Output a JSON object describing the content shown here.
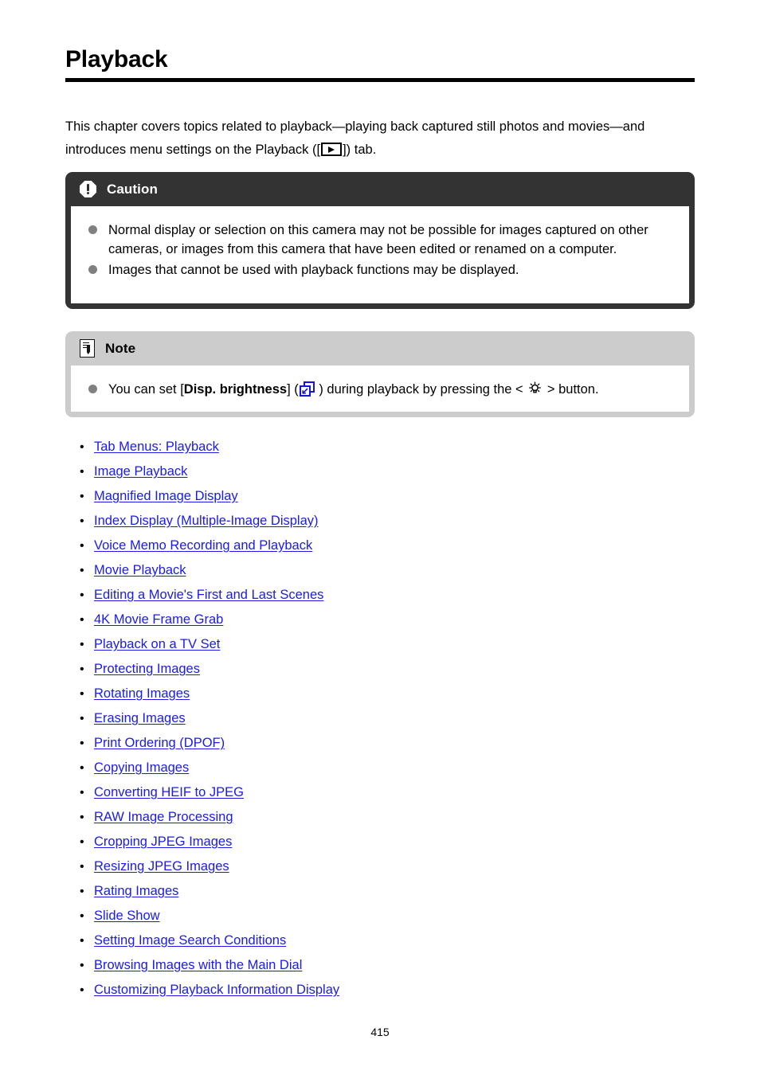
{
  "document": {
    "title": "Playback",
    "page_number": "415"
  },
  "intro": {
    "part1": "This chapter covers topics related to playback—playing back captured still photos and movies—and introduces menu settings on the Playback ([",
    "part2": "]) tab.",
    "icon": "play-tab-icon"
  },
  "caution": {
    "heading": "Caution",
    "icon": "exclamation-icon",
    "header_bg": "#333333",
    "items": [
      "Normal display or selection on this camera may not be possible for images captured on other cameras, or images from this camera that have been edited or renamed on a computer.",
      "Images that cannot be used with playback functions may be displayed."
    ]
  },
  "note": {
    "heading": "Note",
    "icon": "note-sheet-icon",
    "header_bg": "#cccccc",
    "item": {
      "text_before_bracket": "You can set [",
      "bracket_bold": "Disp. brightness",
      "text_after_bracket": "] (",
      "link_icon": "jump-to-page-icon",
      "text_middle": " ) during playback by pressing the < ",
      "brightness_icon": "brightness-lamp-icon",
      "text_after": " > button."
    }
  },
  "links": {
    "bullet": "•",
    "color": "#1a1aee",
    "items": [
      "Tab Menus: Playback",
      "Image Playback",
      "Magnified Image Display",
      "Index Display (Multiple-Image Display)",
      "Voice Memo Recording and Playback",
      "Movie Playback",
      "Editing a Movie's First and Last Scenes",
      "4K Movie Frame Grab",
      "Playback on a TV Set",
      "Protecting Images",
      "Rotating Images",
      "Erasing Images",
      "Print Ordering (DPOF)",
      "Copying Images",
      "Converting HEIF to JPEG",
      "RAW Image Processing",
      "Cropping JPEG Images",
      "Resizing JPEG Images",
      "Rating Images",
      "Slide Show",
      "Setting Image Search Conditions",
      "Browsing Images with the Main Dial",
      "Customizing Playback Information Display"
    ]
  }
}
